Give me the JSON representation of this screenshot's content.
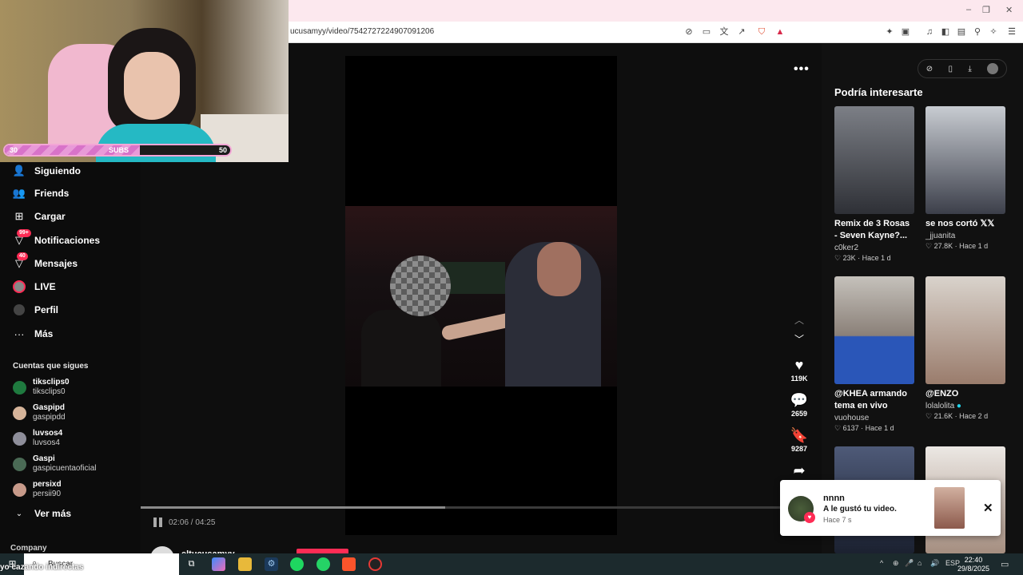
{
  "browser": {
    "url": "ucusamyy/video/7542727224907091206",
    "controls": {
      "minimize": "–",
      "maximize": "❐",
      "close": "✕"
    }
  },
  "stream_overlay": {
    "bar_left": "30",
    "bar_center": "SUBS",
    "bar_right": "50",
    "progress": 0.6
  },
  "sidebar": {
    "items": [
      {
        "label": "Siguiendo",
        "icon": "following-icon"
      },
      {
        "label": "Friends",
        "icon": "friends-icon"
      },
      {
        "label": "Cargar",
        "icon": "upload-icon"
      },
      {
        "label": "Notificaciones",
        "icon": "notifications-icon",
        "badge": "99+"
      },
      {
        "label": "Mensajes",
        "icon": "messages-icon",
        "badge": "40"
      },
      {
        "label": "LIVE",
        "icon": "live-icon"
      },
      {
        "label": "Perfil",
        "icon": "profile-icon"
      },
      {
        "label": "Más",
        "icon": "more-icon"
      }
    ],
    "following_title": "Cuentas que sigues",
    "following": [
      {
        "name": "tiksclips0",
        "handle": "tiksclips0",
        "color": "#1f7a3f"
      },
      {
        "name": "Gaspipd",
        "handle": "gaspipdd",
        "color": "#d6b49a"
      },
      {
        "name": "luvsos4",
        "handle": "luvsos4",
        "color": "#8e8e9a"
      },
      {
        "name": "Gaspi",
        "handle": "gaspicuentaoficial",
        "color": "#4a6a55"
      },
      {
        "name": "persixd",
        "handle": "persii90",
        "color": "#c79a8a"
      }
    ],
    "see_more": "Ver más",
    "company": "Company"
  },
  "player": {
    "time_current": "02:06",
    "time_total": "04:25",
    "time_display": "02:06 / 04:25",
    "progress": 0.476,
    "more": "•••",
    "likes": "119K",
    "comments": "2659",
    "saves": "9287",
    "author": "eltucusamyy"
  },
  "recommendations": {
    "title": "Podría interesarte",
    "cards": [
      {
        "title": "Remix de 3 Rosas - Seven Kayne?...",
        "user": "c0ker2",
        "likes": "23K",
        "age": "Hace 1 d",
        "color": "#5b5f68"
      },
      {
        "title": "se nos cortó 𝕏𝕏",
        "user": "_jjuanita",
        "likes": "27.8K",
        "age": "Hace 1 d",
        "color": "#9aa2ad"
      },
      {
        "title": "@KHEA armando tema en vivo",
        "user": "vuohouse",
        "likes": "6137",
        "age": "Hace 1 d",
        "color": "#2a56b8"
      },
      {
        "title": "@ENZO",
        "user": "lolalolita",
        "likes": "21.6K",
        "age": "Hace 2 d",
        "color": "#b79a86"
      },
      {
        "title": "",
        "user": "",
        "likes": "",
        "age": "",
        "color": "#2b3448"
      },
      {
        "title": "",
        "user": "",
        "likes": "",
        "age": "",
        "color": "#d8d2ce"
      }
    ]
  },
  "notification": {
    "user": "nnnn",
    "message": "A le gustó tu video.",
    "time": "Hace 7 s",
    "close": "✕"
  },
  "taskbar": {
    "search_placeholder": "Buscar",
    "ticker": "yo cazando indirectas",
    "language": "ESP",
    "time": "22:40",
    "date": "29/8/2025"
  }
}
